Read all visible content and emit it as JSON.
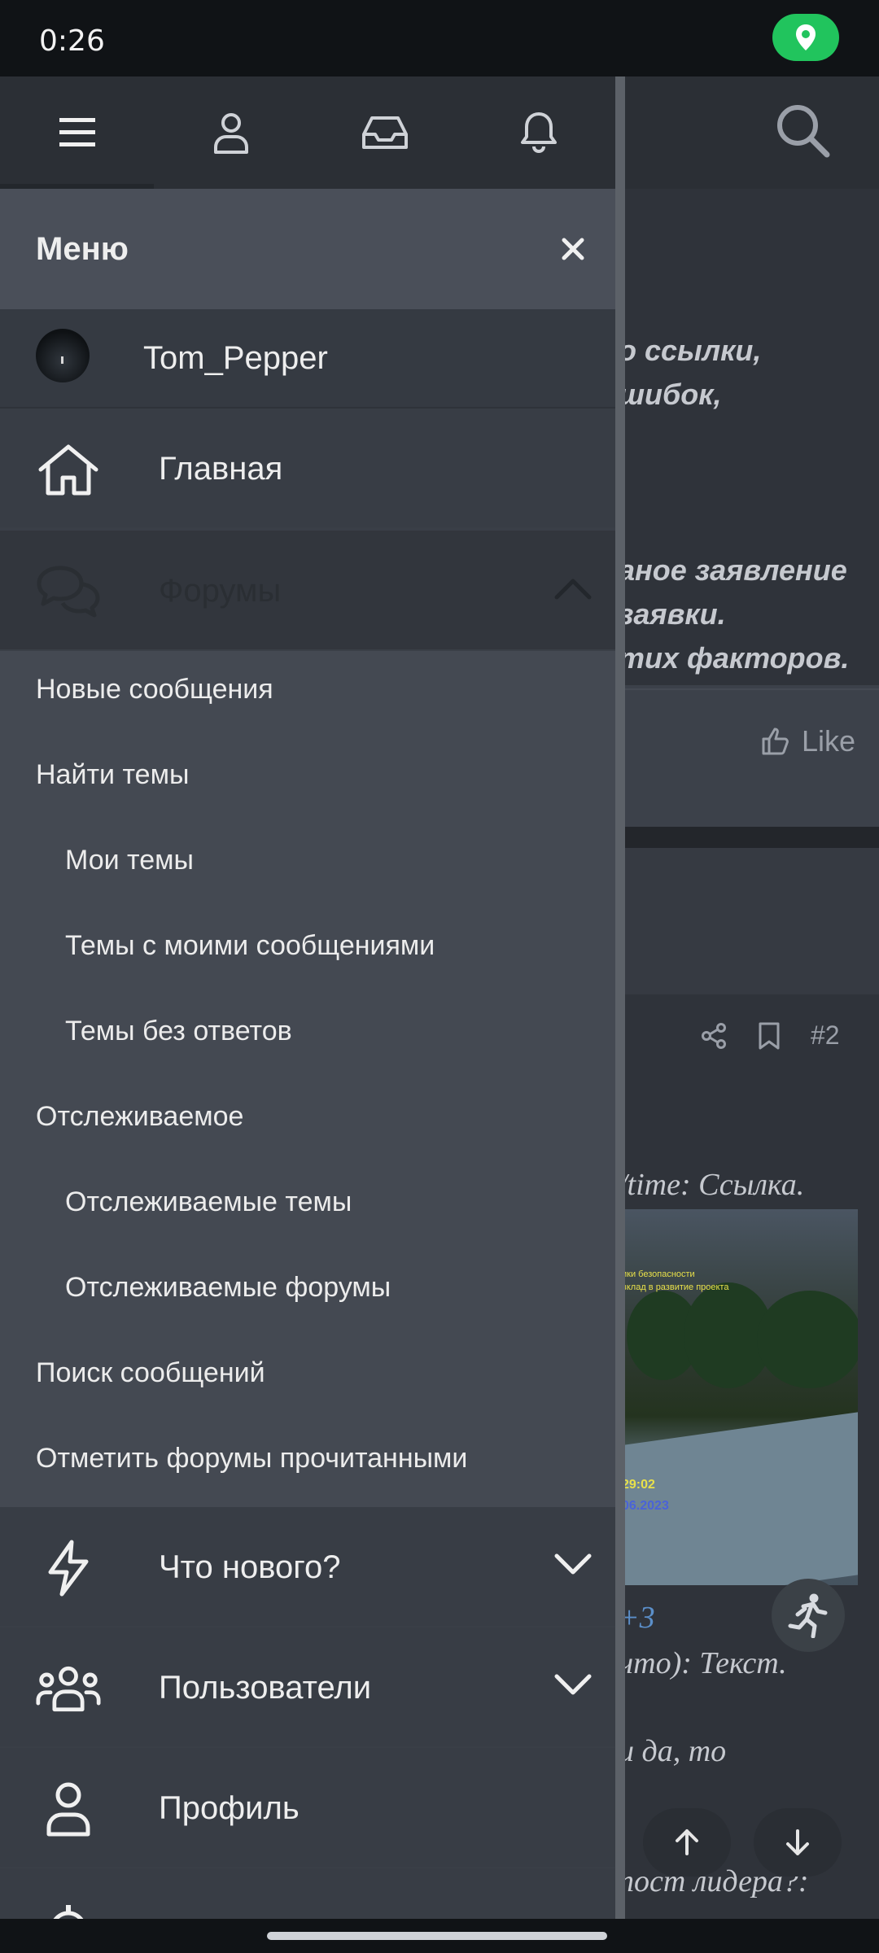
{
  "status_bar": {
    "time": "0:26"
  },
  "background": {
    "post1_lines": [
      "о ссылки,",
      "шибок,",
      "аное заявление",
      "заявки.",
      "тих факторов."
    ],
    "like_label": "Like",
    "post_number": "#2",
    "post2_lines": [
      "/time: Ссылка.",
      "+3",
      "что): Текст.",
      "и да, то",
      ",",
      "пост лидера?:"
    ],
    "image_caption_1": "ики безопасности",
    "image_caption_2": "вклад в развитие проекта",
    "image_time": "29:02",
    "image_date": "06.2023"
  },
  "tabs": [
    {
      "name": "menu",
      "icon": "hamburger-icon"
    },
    {
      "name": "account",
      "icon": "user-icon"
    },
    {
      "name": "inbox",
      "icon": "inbox-icon"
    },
    {
      "name": "alerts",
      "icon": "bell-icon"
    }
  ],
  "menu": {
    "title": "Меню",
    "close_icon": "close-icon",
    "username": "Tom_Pepper",
    "home_label": "Главная",
    "forums_label": "Форумы",
    "forum_links": {
      "new_posts": "Новые сообщения",
      "find_threads": "Найти темы",
      "my_threads": "Мои темы",
      "threads_with_my_posts": "Темы с моими сообщениями",
      "unanswered": "Темы без ответов",
      "watched": "Отслеживаемое",
      "watched_threads": "Отслеживаемые темы",
      "watched_forums": "Отслеживаемые форумы",
      "search_posts": "Поиск сообщений",
      "mark_read": "Отметить форумы прочитанными"
    },
    "whats_new_label": "Что нового?",
    "members_label": "Пользователи",
    "profile_label": "Профиль"
  },
  "colors": {
    "accent_green": "#21c45d",
    "link_blue": "#5b8fc9"
  }
}
